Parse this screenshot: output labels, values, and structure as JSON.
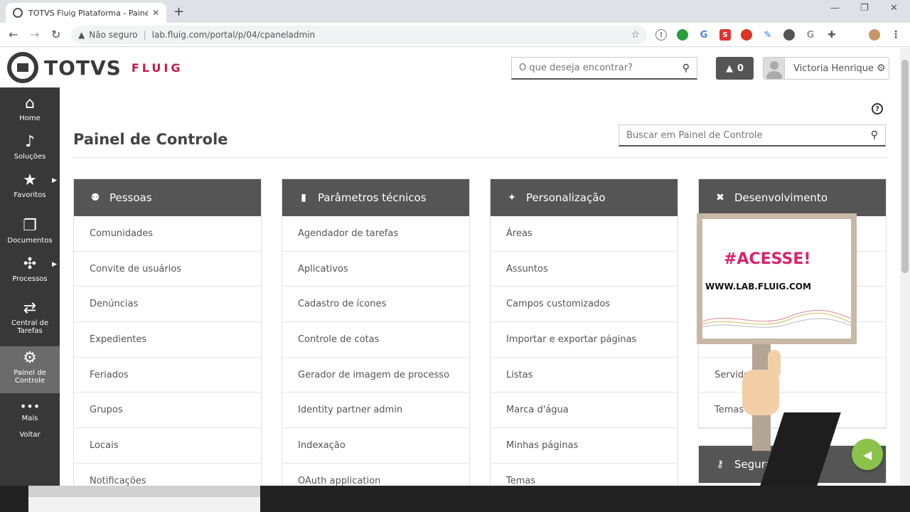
{
  "browser": {
    "tab_title": "TOTVS Fluig Plataforma - Painel d",
    "not_secure": "Não seguro",
    "url": "lab.fluig.com/portal/p/04/cpaneladmin"
  },
  "header": {
    "logo_main": "TOTVS",
    "logo_sub": "FLUIG",
    "search_placeholder": "O que deseja encontrar?",
    "alert_count": "0",
    "user_name": "Victoria Henrique"
  },
  "sidebar": {
    "items": [
      {
        "label": "Home"
      },
      {
        "label": "Soluções"
      },
      {
        "label": "Favoritos"
      },
      {
        "label": "Documentos"
      },
      {
        "label": "Processos"
      },
      {
        "label": "Central de Tarefas"
      },
      {
        "label": "Painel de Controle"
      },
      {
        "label": "Mais"
      },
      {
        "label": "Voltar"
      }
    ]
  },
  "main": {
    "title": "Painel de Controle",
    "search_placeholder": "Buscar em Painel de Controle",
    "cards": [
      {
        "title": "Pessoas",
        "items": [
          "Comunidades",
          "Convite de usuários",
          "Denúncias",
          "Expedientes",
          "Feriados",
          "Grupos",
          "Locais",
          "Notificações"
        ]
      },
      {
        "title": "Parâmetros técnicos",
        "items": [
          "Agendador de tarefas",
          "Aplicativos",
          "Cadastro de ícones",
          "Controle de cotas",
          "Gerador de imagem de processo",
          "Identity partner admin",
          "Indexação",
          "OAuth application"
        ]
      },
      {
        "title": "Personalização",
        "items": [
          "Áreas",
          "Assuntos",
          "Campos customizados",
          "Importar e exportar páginas",
          "Listas",
          "Marca d'água",
          "Minhas páginas",
          "Temas"
        ]
      },
      {
        "title": "Desenvolvimento",
        "items": [
          "",
          "",
          "",
          "",
          "Servidor",
          "Temas"
        ]
      }
    ],
    "security_card_title": "Segurança"
  },
  "promo": {
    "title": "#ACESSE!",
    "url": "WWW.LAB.FLUIG.COM"
  }
}
